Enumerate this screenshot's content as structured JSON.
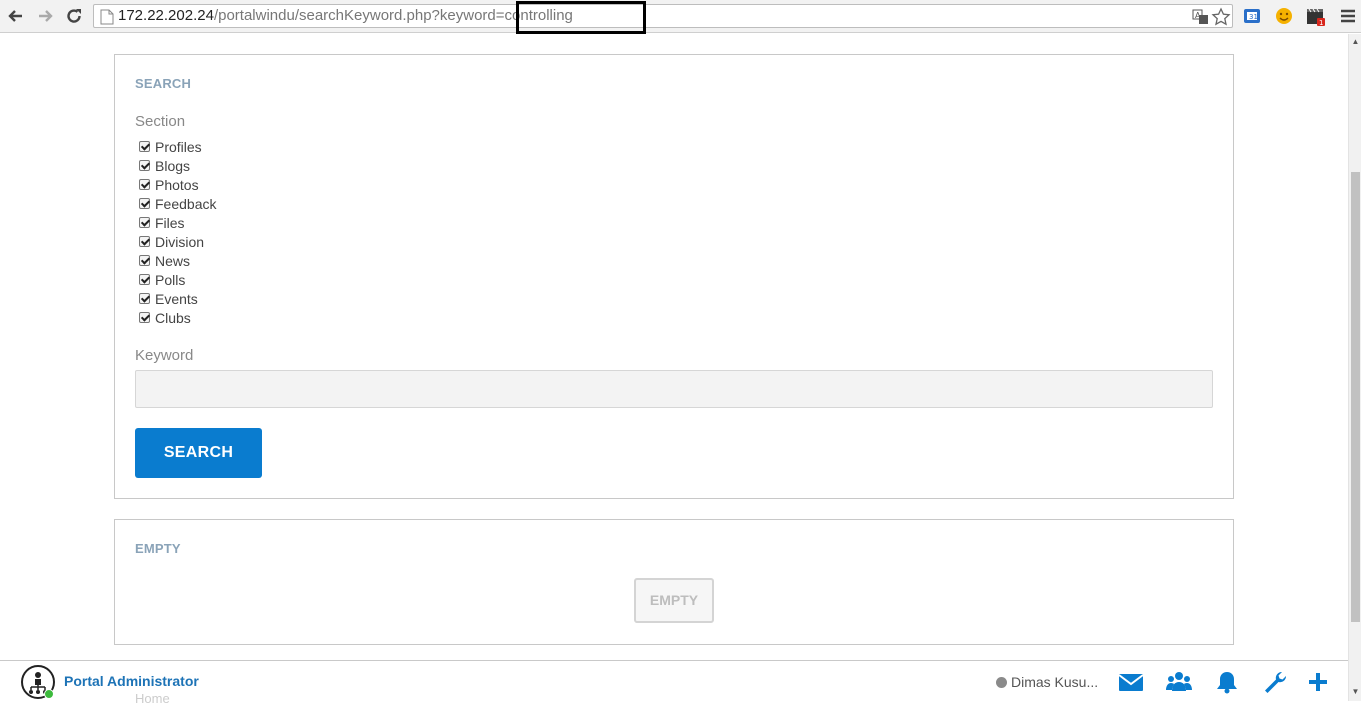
{
  "browser": {
    "url_host": "172.22.202.24",
    "url_path": "/portalwindu/searchKeyword.php?keyword=controlling"
  },
  "search_panel": {
    "title": "SEARCH",
    "section_label": "Section",
    "sections": [
      {
        "label": "Profiles",
        "checked": true
      },
      {
        "label": "Blogs",
        "checked": true
      },
      {
        "label": "Photos",
        "checked": true
      },
      {
        "label": "Feedback",
        "checked": true
      },
      {
        "label": "Files",
        "checked": true
      },
      {
        "label": "Division",
        "checked": true
      },
      {
        "label": "News",
        "checked": true
      },
      {
        "label": "Polls",
        "checked": true
      },
      {
        "label": "Events",
        "checked": true
      },
      {
        "label": "Clubs",
        "checked": true
      }
    ],
    "keyword_label": "Keyword",
    "keyword_value": "",
    "search_button": "SEARCH"
  },
  "empty_panel": {
    "title": "EMPTY",
    "empty_badge": "EMPTY"
  },
  "bottom_bar": {
    "admin_name": "Portal Administrator",
    "under_text": "Home",
    "user_status": "Dimas Kusu..."
  },
  "colors": {
    "accent": "#0a7ccf",
    "link": "#1d73b6",
    "panel_title": "#8aa3b8"
  }
}
